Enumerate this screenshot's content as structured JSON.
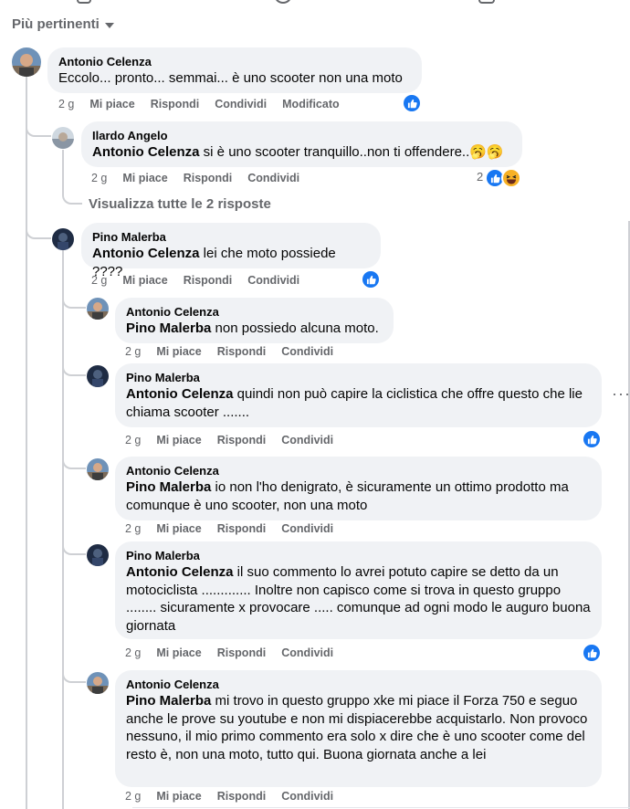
{
  "sort": {
    "label": "Più pertinenti"
  },
  "actions": {
    "like": "Mi piace",
    "reply": "Rispondi",
    "share": "Condividi",
    "edited": "Modificato"
  },
  "comments": [
    {
      "author": "Antonio Celenza",
      "tag": "",
      "text": "Eccolo... pronto... semmai... è uno scooter non una moto",
      "time": "2 g",
      "edited": "Modificato"
    },
    {
      "author": "Ilardo Angelo",
      "tag": "Antonio Celenza",
      "text": " si è uno scooter tranquillo..non ti offendere..🥱🥱",
      "time": "2 g",
      "reactions_count": "2"
    },
    {
      "author": "Pino Malerba",
      "tag": "Antonio Celenza",
      "text": " lei che moto possiede ????",
      "time": "2 g"
    },
    {
      "author": "Antonio Celenza",
      "tag": "Pino Malerba",
      "text": " non possiedo alcuna moto.",
      "time": "2 g"
    },
    {
      "author": "Pino Malerba",
      "tag": "Antonio Celenza",
      "text": " quindi non può capire la ciclistica che offre questo che lie chiama scooter .......",
      "time": "2 g"
    },
    {
      "author": "Antonio Celenza",
      "tag": "Pino Malerba",
      "text": " io non l'ho denigrato, è sicuramente un ottimo prodotto ma comunque è uno scooter, non una moto",
      "time": "2 g"
    },
    {
      "author": "Pino Malerba",
      "tag": "Antonio Celenza",
      "text": " il suo commento lo avrei potuto capire se detto da un motociclista ............. Inoltre non capisco come si trova in questo gruppo ........ sicuramente x provocare ..... comunque ad ogni modo le auguro buona giornata",
      "time": "2 g"
    },
    {
      "author": "Antonio Celenza",
      "tag": "Pino Malerba",
      "text": " mi trovo in questo gruppo xke mi piace il Forza 750 e seguo anche le prove su youtube e non mi dispiacerebbe acquistarlo. Non provoco nessuno, il mio primo commento era solo x dire che è uno scooter come del resto è, non una moto, tutto qui. Buona giornata anche a lei",
      "time": "2 g"
    }
  ],
  "view_replies": "Visualizza tutte le 2 risposte"
}
